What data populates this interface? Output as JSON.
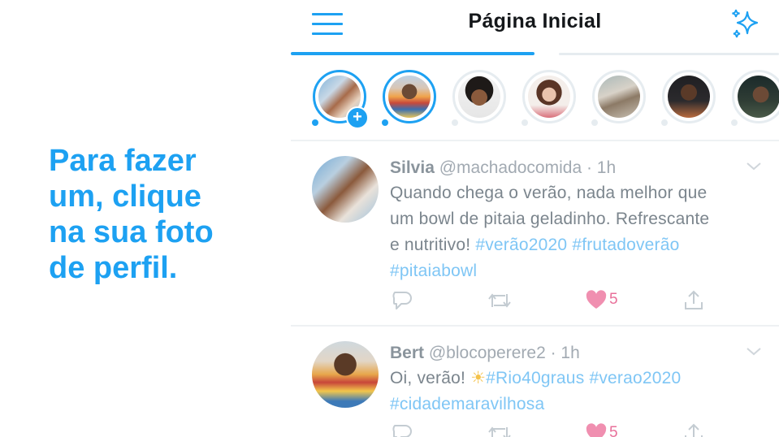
{
  "caption": {
    "lines": [
      "Para fazer",
      "um, clique",
      "na sua foto",
      "de perfil."
    ]
  },
  "header": {
    "title": "Página Inicial",
    "left_icon": "hamburger-menu-icon",
    "right_icon": "sparkle-icon"
  },
  "colors": {
    "accent": "#1da1f2",
    "like": "#e0245e",
    "muted_text": "#8a949c",
    "hashtag": "#7fc6f5"
  },
  "fleets": [
    {
      "name": "your-fleet",
      "ring": "live",
      "plus": "+"
    },
    {
      "name": "fleet-2",
      "ring": "live"
    },
    {
      "name": "fleet-3",
      "ring": "seen"
    },
    {
      "name": "fleet-4",
      "ring": "seen"
    },
    {
      "name": "fleet-5",
      "ring": "seen"
    },
    {
      "name": "fleet-6",
      "ring": "seen"
    },
    {
      "name": "fleet-7",
      "ring": "seen"
    }
  ],
  "tweets": [
    {
      "name": "Silvia",
      "handle": "@machadocomida",
      "time": "· 1h",
      "text_lines": [
        {
          "text": "Quando chega o verão, nada melhor que"
        },
        {
          "text": "um bowl de pitaia geladinho. Refrescante"
        },
        {
          "text": "e nutritivo! ",
          "tags": [
            "#verão2020",
            "#frutadoverão"
          ]
        },
        {
          "text": "",
          "tags": [
            "#pitaiabowl"
          ]
        }
      ],
      "likes": "5"
    },
    {
      "name": "Bert",
      "handle": "@blocoperere2",
      "time": "· 1h",
      "text_lines": [
        {
          "text": "Oi, verão! ",
          "emoji": "☀",
          "tags": [
            "#Rio40graus",
            "#verao2020"
          ]
        },
        {
          "text": "",
          "tags": [
            "#cidademaravilhosa"
          ]
        }
      ],
      "likes": "5"
    }
  ]
}
